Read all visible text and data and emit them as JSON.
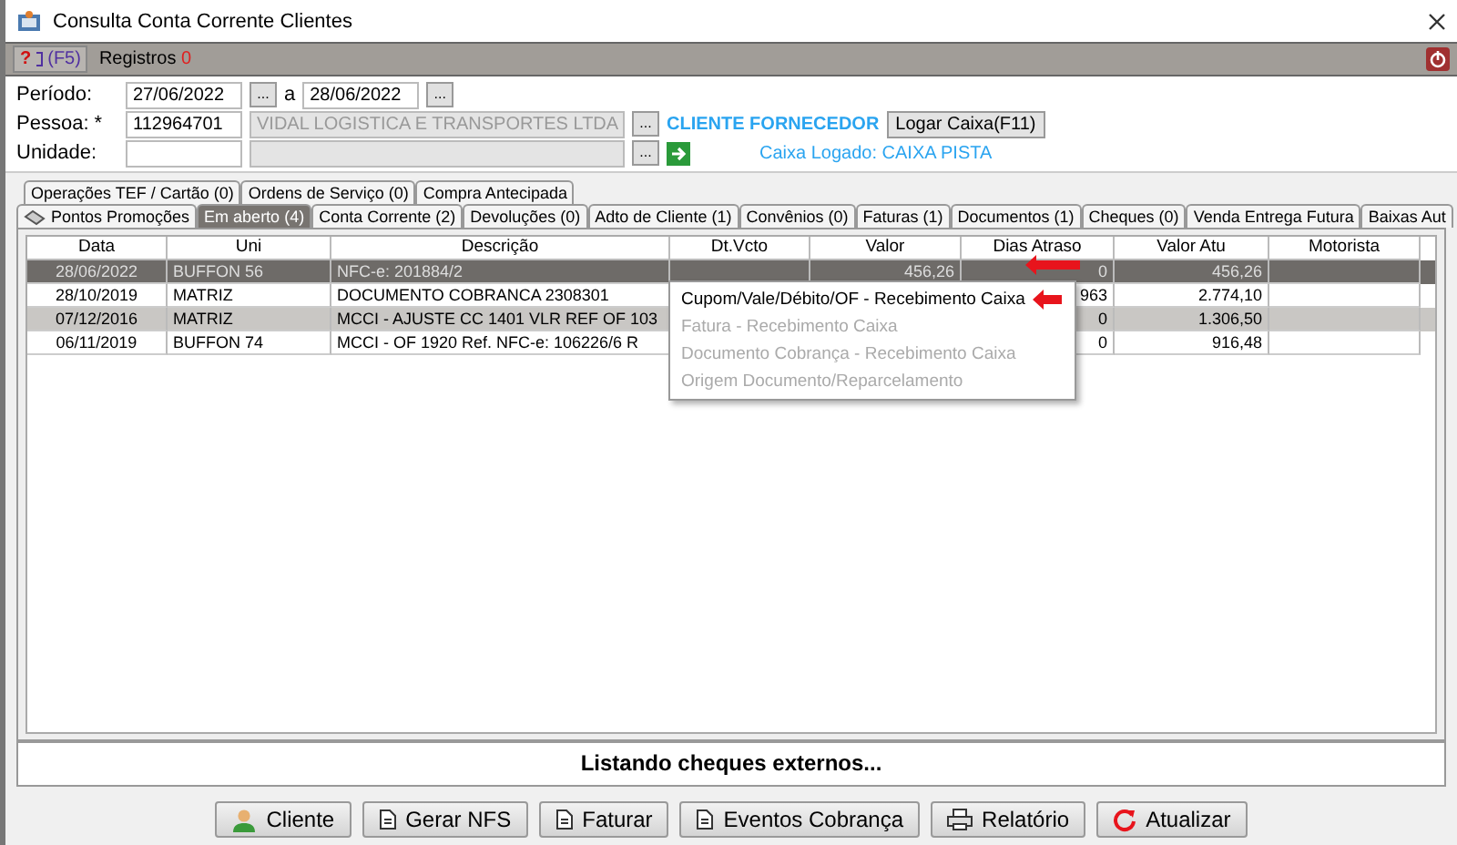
{
  "window": {
    "title": "Consulta Conta Corrente Clientes"
  },
  "toolbar": {
    "help_label": "?",
    "help_key": "(F5)",
    "records_label": "Registros",
    "records_count": "0"
  },
  "form": {
    "periodo_label": "Período:",
    "date_from": "27/06/2022",
    "date_sep": "a",
    "date_to": "28/06/2022",
    "pessoa_label": "Pessoa: *",
    "pessoa_code": "112964701",
    "pessoa_name": "VIDAL LOGISTICA E TRANSPORTES LTDA",
    "unidade_label": "Unidade:",
    "client_type": "CLIENTE FORNECEDOR",
    "login_button": "Logar Caixa(F11)",
    "caixa_status": "Caixa Logado: CAIXA PISTA",
    "lookup_button": "..."
  },
  "tabs_back": [
    {
      "label": "Operações TEF / Cartão (0)",
      "selected": false
    },
    {
      "label": "Ordens de Serviço (0)",
      "selected": false
    },
    {
      "label": "Compra Antecipada",
      "selected": false
    }
  ],
  "tabs_front": [
    {
      "label": "Pontos Promoções",
      "selected": false,
      "icon": true
    },
    {
      "label": "Em aberto (4)",
      "selected": true
    },
    {
      "label": "Conta Corrente (2)",
      "selected": false
    },
    {
      "label": "Devoluções (0)",
      "selected": false
    },
    {
      "label": "Adto de Cliente (1)",
      "selected": false
    },
    {
      "label": "Convênios (0)",
      "selected": false
    },
    {
      "label": "Faturas (1)",
      "selected": false
    },
    {
      "label": "Documentos (1)",
      "selected": false
    },
    {
      "label": "Cheques (0)",
      "selected": false
    },
    {
      "label": "Venda Entrega Futura",
      "selected": false
    },
    {
      "label": "Baixas Aut",
      "selected": false
    }
  ],
  "table": {
    "columns": [
      "Data",
      "Uni",
      "Descrição",
      "Dt.Vcto",
      "Valor",
      "Dias Atraso",
      "Valor Atu",
      "Motorista"
    ],
    "rows": [
      {
        "cells": [
          "28/06/2022",
          "BUFFON 56",
          "NFC-e: 201884/2",
          "",
          "456,26",
          "0",
          "456,26",
          ""
        ],
        "selected": true,
        "highlighted": false
      },
      {
        "cells": [
          "28/10/2019",
          "MATRIZ",
          "DOCUMENTO COBRANCA 2308301",
          "",
          "",
          "963",
          "2.774,10",
          ""
        ],
        "selected": false,
        "highlighted": false
      },
      {
        "cells": [
          "07/12/2016",
          "MATRIZ",
          "MCCI - AJUSTE CC 1401 VLR REF OF 103",
          "",
          "",
          "0",
          "1.306,50",
          ""
        ],
        "selected": false,
        "highlighted": true
      },
      {
        "cells": [
          "06/11/2019",
          "BUFFON 74",
          "MCCI - OF 1920 Ref. NFC-e: 106226/6 R",
          "",
          "",
          "0",
          "916,48",
          ""
        ],
        "selected": false,
        "highlighted": false
      }
    ]
  },
  "context_menu": [
    {
      "label": "Cupom/Vale/Débito/OF - Recebimento Caixa",
      "disabled": false,
      "pointer": true
    },
    {
      "label": "Fatura - Recebimento Caixa",
      "disabled": true,
      "pointer": false
    },
    {
      "label": "Documento Cobrança - Recebimento Caixa",
      "disabled": true,
      "pointer": false
    },
    {
      "label": "Origem Documento/Reparcelamento",
      "disabled": true,
      "pointer": false
    }
  ],
  "status_bar": "Listando cheques externos...",
  "buttons": [
    {
      "label": "Cliente",
      "kind": "person"
    },
    {
      "label": "Gerar NFS",
      "kind": "doc"
    },
    {
      "label": "Faturar",
      "kind": "doc"
    },
    {
      "label": "Eventos Cobrança",
      "kind": "doc"
    },
    {
      "label": "Relatório",
      "kind": "printer"
    },
    {
      "label": "Atualizar",
      "kind": "refresh"
    }
  ]
}
